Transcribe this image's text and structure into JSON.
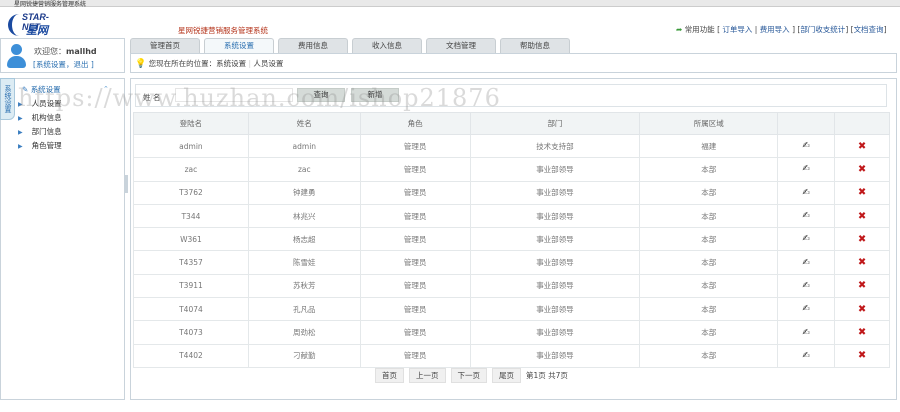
{
  "window_title": "星网锐捷营销服务管理系统",
  "logo": {
    "en": "STAR-NET",
    "cn": "星网锐捷"
  },
  "system_title": "星网锐捷营销服务管理系统",
  "quick_links": {
    "label": "常用功能",
    "items": [
      "订单导入",
      "费用导入",
      "部门收支统计",
      "文档查询"
    ]
  },
  "user": {
    "welcome": "欢迎您：",
    "name": "mallhd",
    "links": [
      "系统设置",
      "退出"
    ]
  },
  "tabs": [
    {
      "label": "管理首页"
    },
    {
      "label": "系统设置",
      "active": true
    },
    {
      "label": "费用信息"
    },
    {
      "label": "收入信息"
    },
    {
      "label": "文档管理"
    },
    {
      "label": "帮助信息"
    }
  ],
  "breadcrumb": {
    "prefix": "您现在所在的位置：",
    "items": [
      "系统设置",
      "人员设置"
    ]
  },
  "sidebar": {
    "vtab": "系统设置",
    "heading": "系统设置",
    "items": [
      "人员设置",
      "机构信息",
      "部门信息",
      "角色管理"
    ]
  },
  "search": {
    "name_label": "姓    名",
    "name_value": "",
    "query_button": "查询",
    "add_button": "新增"
  },
  "table": {
    "headers": [
      "登陆名",
      "姓名",
      "角色",
      "部门",
      "所属区域",
      "",
      ""
    ],
    "rows": [
      [
        "admin",
        "admin",
        "管理员",
        "技术支持部",
        "福建"
      ],
      [
        "zac",
        "zac",
        "管理员",
        "事业部领导",
        "本部"
      ],
      [
        "T3762",
        "钟建勇",
        "管理员",
        "事业部领导",
        "本部"
      ],
      [
        "T344",
        "林兆兴",
        "管理员",
        "事业部领导",
        "本部"
      ],
      [
        "W361",
        "杨志超",
        "管理员",
        "事业部领导",
        "本部"
      ],
      [
        "T4357",
        "陈雪娃",
        "管理员",
        "事业部领导",
        "本部"
      ],
      [
        "T3911",
        "苏秋芳",
        "管理员",
        "事业部领导",
        "本部"
      ],
      [
        "T4074",
        "孔凡品",
        "管理员",
        "事业部领导",
        "本部"
      ],
      [
        "T4073",
        "周劲松",
        "管理员",
        "事业部领导",
        "本部"
      ],
      [
        "T4402",
        "刁献勤",
        "管理员",
        "事业部领导",
        "本部"
      ]
    ]
  },
  "pager": {
    "first": "首页",
    "prev": "上一页",
    "next": "下一页",
    "last": "尾页",
    "info": "第1页 共7页"
  },
  "watermark": "https://www.huzhan.com/ishop21876",
  "colors": {
    "accent": "#2a6fb0",
    "delete": "#c0181a",
    "title_red": "#b4331a"
  }
}
